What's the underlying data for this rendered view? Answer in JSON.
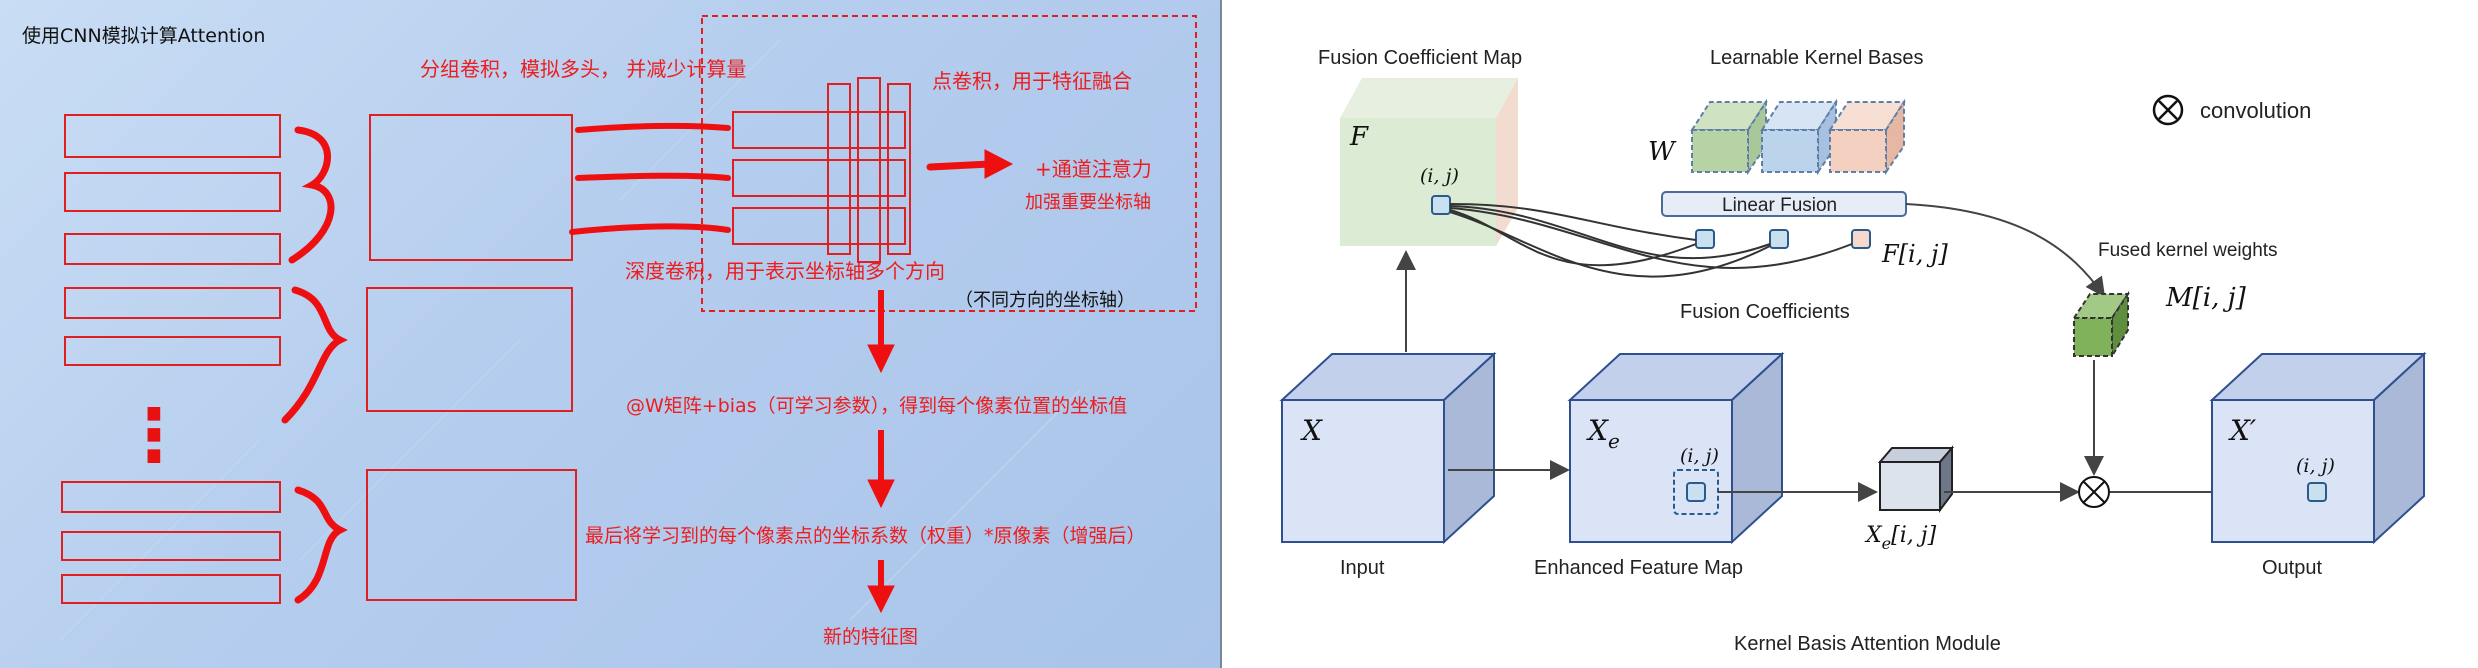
{
  "left": {
    "title": "使用CNN模拟计算Attention",
    "group_conv": "分组卷积，模拟多头， 并减少计算量",
    "point_conv": "点卷积，用于特征融合",
    "channel_attn": "+通道注意力",
    "channel_attn_sub": "加强重要坐标轴",
    "depth_conv": "深度卷积，用于表示坐标轴多个方向",
    "depth_conv_sub": "（不同方向的坐标轴）",
    "w_matrix": "@W矩阵+bias（可学习参数），得到每个像素位置的坐标值",
    "final_step": "最后将学习到的每个像素点的坐标系数（权重）*原像素（增强后）",
    "new_feature": "新的特征图",
    "ellipsis": "⋮"
  },
  "right": {
    "fusion_map_label": "Fusion Coefficient Map",
    "kernel_bases_label": "Learnable Kernel Bases",
    "conv_legend": "convolution",
    "F_label": "F",
    "W_label": "W",
    "ij_label": "(i, j)",
    "linear_fusion": "Linear Fusion",
    "F_ij": "F[i, j]",
    "fusion_coeffs": "Fusion Coefficients",
    "fused_kernel_weights": "Fused kernel weights",
    "M_ij": "M[i, j]",
    "X_label": "X",
    "Xe_label": "X",
    "Xe_sub": "e",
    "Xprime_label": "X′",
    "Xe_ij_main": "X",
    "Xe_ij_sub": "e",
    "Xe_ij_tail": "[i, j]",
    "input": "Input",
    "enhanced": "Enhanced Feature Map",
    "output": "Output",
    "module_title": "Kernel Basis Attention Module",
    "colors": {
      "fusion_map": "#dcebd3",
      "cube_front": "#dbe4f7",
      "cube_side": "#aab9d8",
      "cube_top": "#c3d0ec",
      "cube_stroke": "#2f4f8f",
      "kernel_green": "#b7d3a6",
      "kernel_blue": "#bcd3ec",
      "kernel_peach": "#f3d0c0",
      "fused_kernel": "#7fb25a"
    }
  }
}
